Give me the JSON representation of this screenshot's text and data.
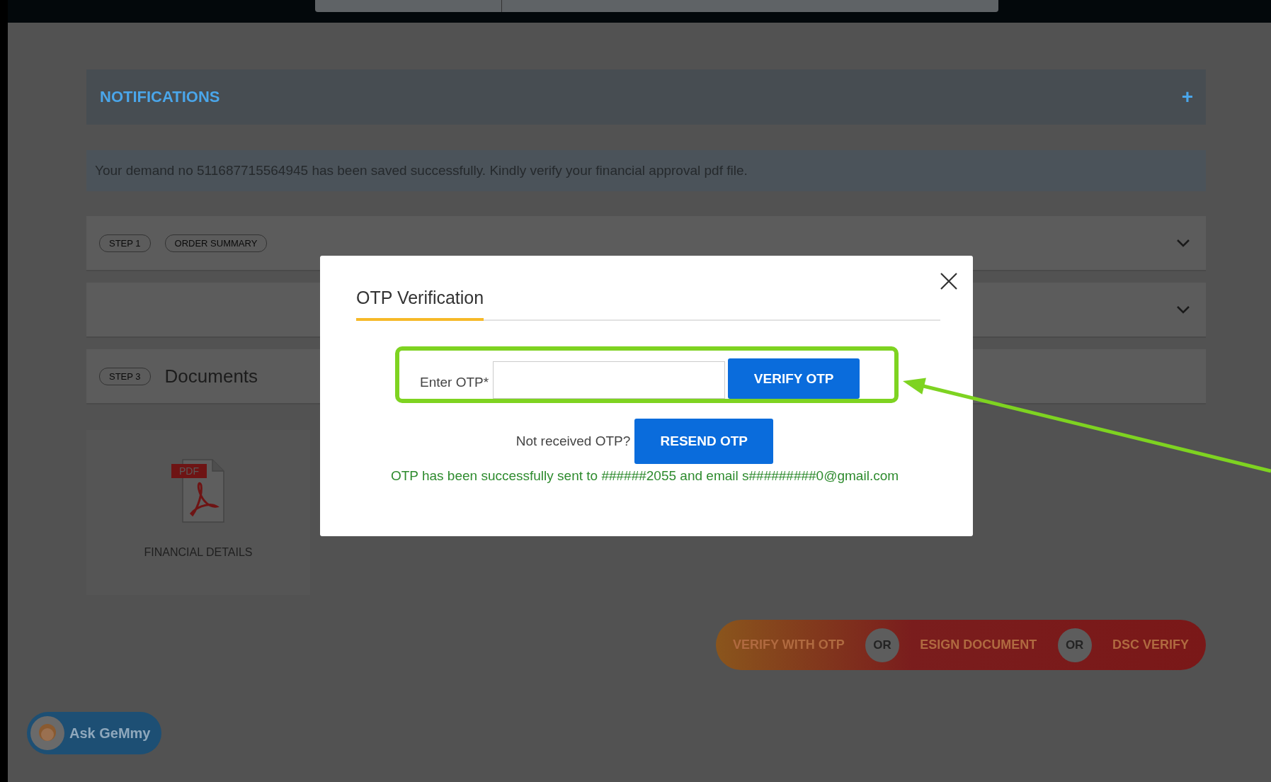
{
  "notifications": {
    "title": "NOTIFICATIONS",
    "toggle": "+"
  },
  "message": "Your demand no 511687715564945 has been saved successfully. Kindly verify your financial approval pdf file.",
  "sections": [
    {
      "kind": "accordion",
      "badges": [
        "STEP 1",
        "ORDER SUMMARY"
      ]
    },
    {
      "kind": "accordion"
    },
    {
      "kind": "heading",
      "badges": [
        "STEP 3"
      ],
      "title": "Documents"
    }
  ],
  "documents": [
    {
      "badge": "PDF",
      "label": "FINANCIAL DETAILS"
    }
  ],
  "verify_actions": [
    {
      "kind": "action",
      "label": "VERIFY WITH OTP"
    },
    {
      "kind": "separator",
      "label": "OR"
    },
    {
      "kind": "action",
      "label": "ESIGN DOCUMENT"
    },
    {
      "kind": "separator",
      "label": "OR"
    },
    {
      "kind": "action",
      "label": "DSC VERIFY"
    }
  ],
  "assistant": {
    "label": "Ask GeMmy"
  },
  "dialog": {
    "title": "OTP Verification",
    "otp_label": "Enter OTP*",
    "verify_button": "VERIFY OTP",
    "resend_prompt": "Not received OTP?",
    "resend_button": "RESEND OTP",
    "status": "OTP has been successfully sent to ######2055 and email s#########0@gmail.com"
  }
}
